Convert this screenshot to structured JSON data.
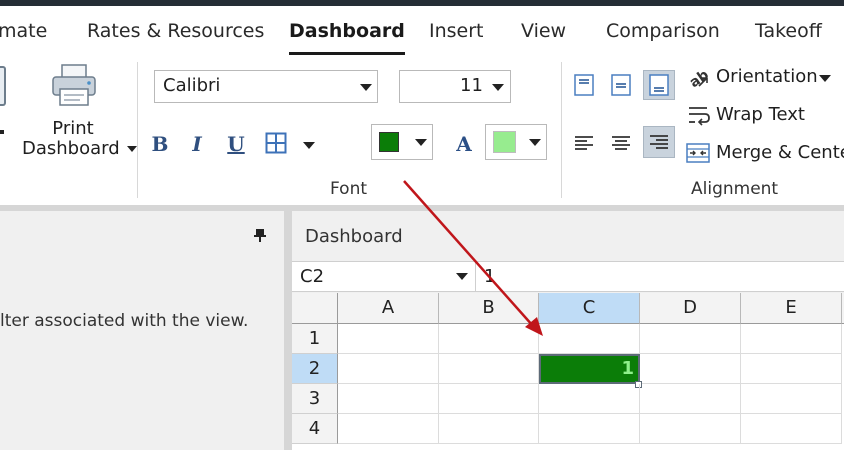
{
  "tabs": [
    {
      "label": "mate"
    },
    {
      "label": "Rates & Resources"
    },
    {
      "label": "Dashboard",
      "active": true
    },
    {
      "label": "Insert"
    },
    {
      "label": "View"
    },
    {
      "label": "Comparison"
    },
    {
      "label": "Takeoff"
    }
  ],
  "ribbon": {
    "print": {
      "line1": "Print",
      "line2": "Dashboard"
    },
    "font": {
      "family": "Calibri",
      "size": "11",
      "group_label": "Font",
      "bold": "B",
      "italic": "I",
      "underline": "U",
      "font_color_letter": "A",
      "fill_color": "#0b7d08",
      "font_color": "#97ec8f"
    },
    "alignment": {
      "group_label": "Alignment",
      "orientation": "Orientation",
      "wrap_text": "Wrap Text",
      "merge_center": "Merge & Center"
    }
  },
  "left_panel": {
    "text": "lter associated with the view."
  },
  "sheet": {
    "title": "Dashboard",
    "name_box": "C2",
    "formula_value": "1",
    "columns": [
      "A",
      "B",
      "C",
      "D",
      "E"
    ],
    "rows": [
      "1",
      "2",
      "3",
      "4"
    ],
    "selected_column": "C",
    "selected_row": "2",
    "active_cell_value": "1"
  },
  "colors": {
    "accent": "#bfdcf6",
    "arrow": "#c0161b"
  }
}
